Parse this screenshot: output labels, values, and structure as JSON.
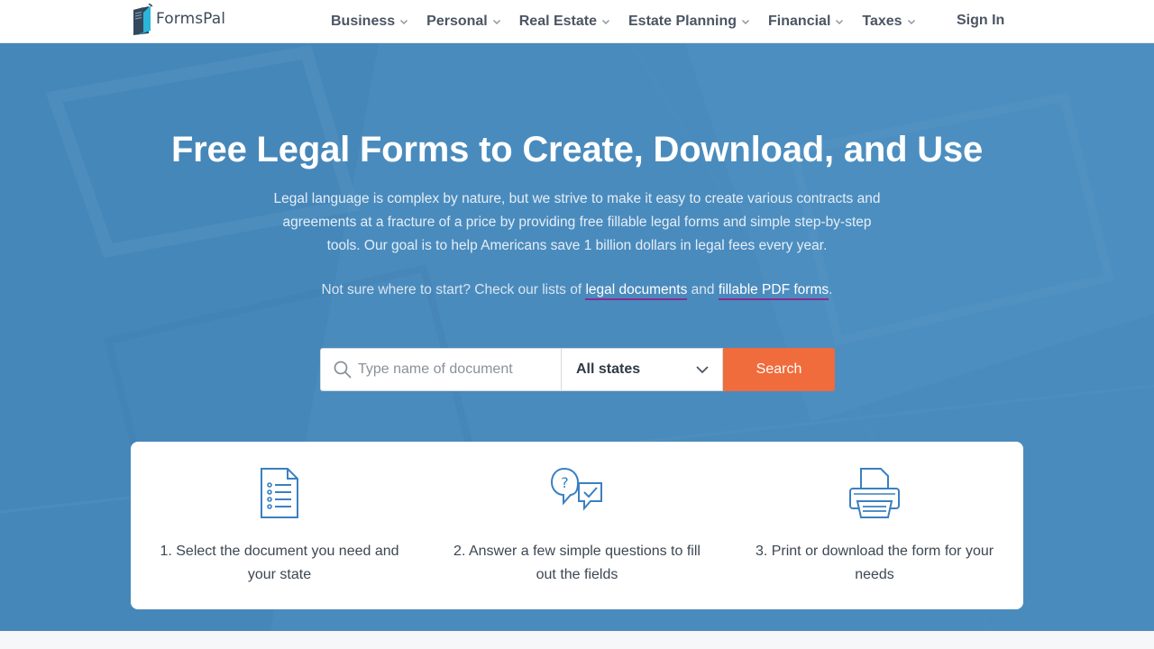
{
  "brand": {
    "name": "FormsPal"
  },
  "nav": {
    "items": [
      {
        "label": "Business"
      },
      {
        "label": "Personal"
      },
      {
        "label": "Real Estate"
      },
      {
        "label": "Estate Planning"
      },
      {
        "label": "Financial"
      },
      {
        "label": "Taxes"
      }
    ],
    "sign_in": "Sign In"
  },
  "hero": {
    "title": "Free Legal Forms to Create, Download, and Use",
    "description": "Legal language is complex by nature, but we strive to make it easy to create various contracts and agreements at a fracture of a price by providing free fillable legal forms and simple step-by-step tools. Our goal is to help Americans save 1 billion dollars in legal fees every year.",
    "hint_prefix": "Not sure where to start? Check our lists of ",
    "hint_link1": "legal documents",
    "hint_middle": " and ",
    "hint_link2": "fillable PDF forms",
    "hint_suffix": "."
  },
  "search": {
    "placeholder": "Type name of document",
    "value": "",
    "state_selected": "All states",
    "button_label": "Search"
  },
  "steps": [
    {
      "icon": "document-list-icon",
      "text": "1. Select the document you need and your state"
    },
    {
      "icon": "question-check-chat-icon",
      "text": "2. Answer a few simple questions to fill out the fields"
    },
    {
      "icon": "printer-icon",
      "text": "3. Print or download the form for your needs"
    }
  ],
  "colors": {
    "hero_bg": "#4a8bbd",
    "accent": "#f06c3c",
    "icon": "#3a80c1",
    "link_underline": "#8b2a8f"
  }
}
